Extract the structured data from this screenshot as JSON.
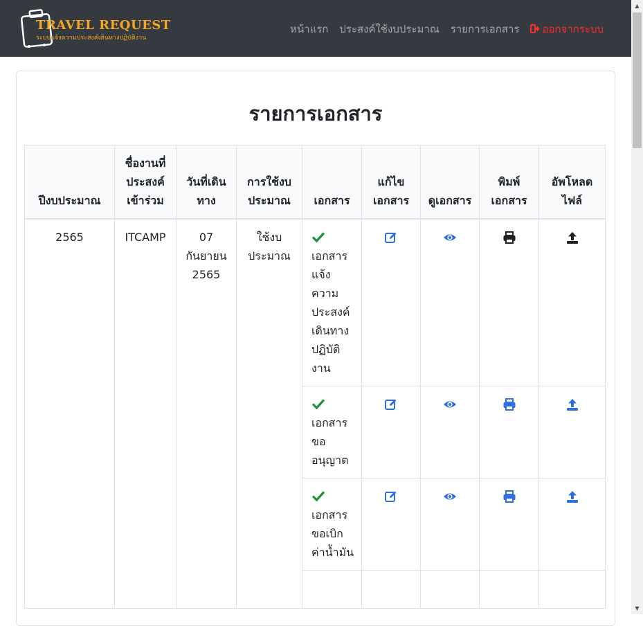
{
  "navbar": {
    "brand_title": "TRAVEL REQUEST",
    "brand_subtitle": "ระบบแจ้งความประสงค์เดินทางปฏิบัติงาน",
    "links": [
      "หน้าแรก",
      "ประสงค์ใช้งบประมาณ",
      "รายการเอกสาร"
    ],
    "logout_label": "ออกจากระบบ"
  },
  "page": {
    "title": "รายการเอกสาร"
  },
  "table": {
    "headers": [
      "ปีงบประมาณ",
      "ชื่องานที่ประสงค์เข้าร่วม",
      "วันที่เดินทาง",
      "การใช้งบประมาณ",
      "เอกสาร",
      "แก้ไขเอกสาร",
      "ดูเอกสาร",
      "พิมพ์เอกสาร",
      "อัพโหลดไฟล์"
    ],
    "row": {
      "year": "2565",
      "event": "ITCAMP",
      "date": "07 กันยายน 2565",
      "budget": "ใช้งบประมาณ",
      "documents": [
        "เอกสารแจ้งความประสงค์เดินทางปฏิบัติงาน",
        "เอกสารขออนุญาต",
        "เอกสารขอเบิกค่าน้ำมัน"
      ]
    }
  },
  "colors": {
    "navbar": "#343a40",
    "brand": "#f5a623",
    "logout": "#ff2a2a",
    "primary": "#2f6de1",
    "success": "#1f8f3a"
  },
  "icons": [
    "check-icon",
    "edit-icon",
    "eye-icon",
    "print-icon",
    "upload-icon"
  ]
}
